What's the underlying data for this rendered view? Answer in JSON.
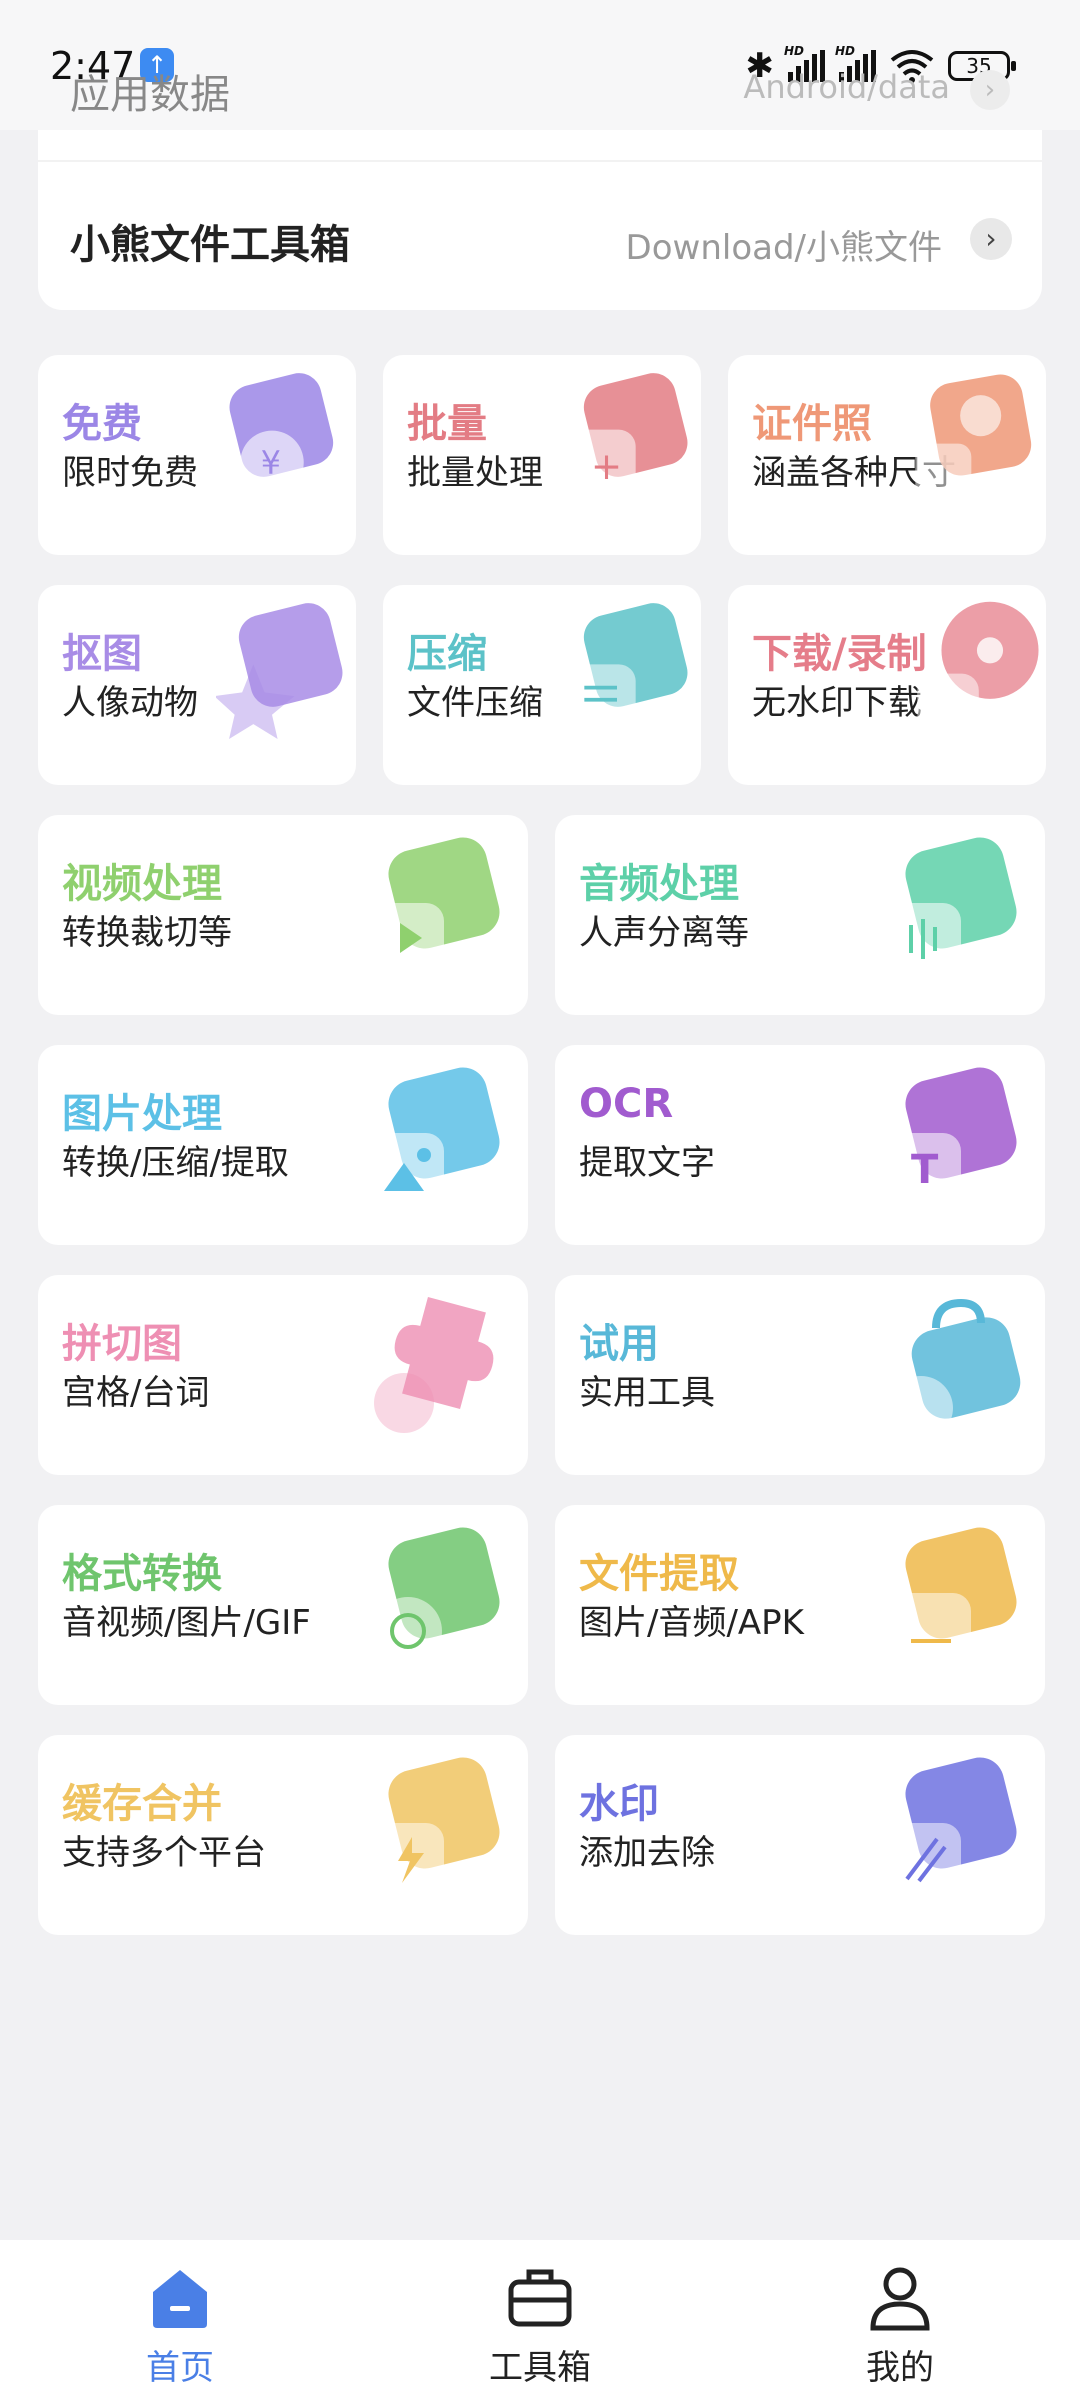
{
  "status": {
    "time": "2:47",
    "battery": "35",
    "hd1": "HD",
    "hd2": "HD"
  },
  "folders": [
    {
      "title": "应用数据",
      "path": "Android/data"
    },
    {
      "title": "小熊文件工具箱",
      "path": "Download/小熊文件"
    }
  ],
  "tools": [
    {
      "title": "免费",
      "subtitle": "限时免费",
      "color": "#9b86e6",
      "icon": "free-icon"
    },
    {
      "title": "批量",
      "subtitle": "批量处理",
      "color": "#e37c84",
      "icon": "batch-icon"
    },
    {
      "title": "证件照",
      "subtitle": "涵盖各种尺寸",
      "color": "#ef9877",
      "icon": "id-photo-icon"
    },
    {
      "title": "抠图",
      "subtitle": "人像动物",
      "color": "#a88ce6",
      "icon": "cutout-icon"
    },
    {
      "title": "压缩",
      "subtitle": "文件压缩",
      "color": "#5cc2c8",
      "icon": "compress-icon"
    },
    {
      "title": "下载/录制",
      "subtitle": "无水印下载",
      "color": "#e57d8a",
      "icon": "download-icon"
    },
    {
      "title": "视频处理",
      "subtitle": "转换裁切等",
      "color": "#8fd06e",
      "icon": "video-icon"
    },
    {
      "title": "音频处理",
      "subtitle": "人声分离等",
      "color": "#5dd0a8",
      "icon": "audio-icon"
    },
    {
      "title": "图片处理",
      "subtitle": "转换/压缩/提取",
      "color": "#5cc0e6",
      "icon": "image-icon"
    },
    {
      "title": "OCR",
      "subtitle": "提取文字",
      "color": "#a15bcf",
      "icon": "ocr-icon"
    },
    {
      "title": "拼切图",
      "subtitle": "宫格/台词",
      "color": "#ee8fb3",
      "icon": "puzzle-icon"
    },
    {
      "title": "试用",
      "subtitle": "实用工具",
      "color": "#58b8d8",
      "icon": "trial-icon"
    },
    {
      "title": "格式转换",
      "subtitle": "音视频/图片/GIF",
      "color": "#6fc56d",
      "icon": "convert-icon"
    },
    {
      "title": "文件提取",
      "subtitle": "图片/音频/APK",
      "color": "#efb94a",
      "icon": "extract-icon"
    },
    {
      "title": "缓存合并",
      "subtitle": "支持多个平台",
      "color": "#f0c462",
      "icon": "cache-merge-icon"
    },
    {
      "title": "水印",
      "subtitle": "添加去除",
      "color": "#6e72e0",
      "icon": "watermark-icon"
    }
  ],
  "nav": [
    {
      "label": "首页",
      "icon": "home-icon",
      "active": true
    },
    {
      "label": "工具箱",
      "icon": "toolbox-icon",
      "active": false
    },
    {
      "label": "我的",
      "icon": "profile-icon",
      "active": false
    }
  ],
  "colors": {
    "accent": "#4a7fe6"
  }
}
